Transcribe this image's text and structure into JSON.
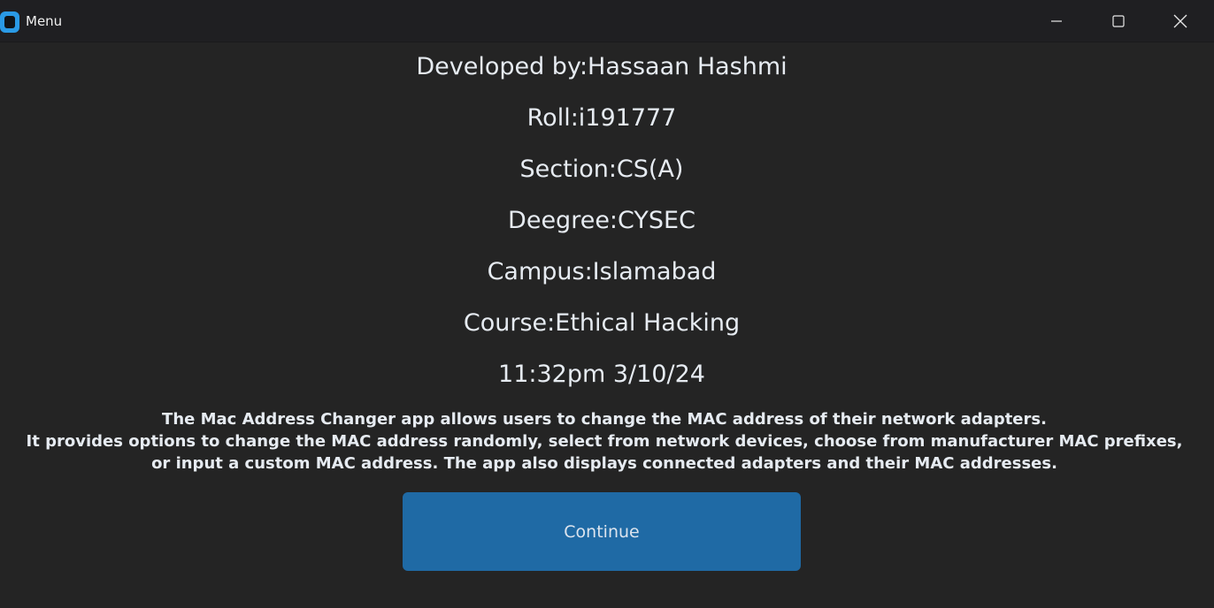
{
  "window": {
    "title": "Menu",
    "controls": {
      "minimize_icon": "minimize-icon",
      "maximize_icon": "maximize-icon",
      "close_icon": "close-icon"
    }
  },
  "info": {
    "developer": "Developed by:Hassaan Hashmi",
    "roll": "Roll:i191777",
    "section": "Section:CS(A)",
    "degree": "Deegree:CYSEC",
    "campus": "Campus:Islamabad",
    "course": "Course:Ethical Hacking",
    "datetime": "11:32pm 3/10/24"
  },
  "description": {
    "line1": "The Mac Address Changer app allows users to change the MAC address of their network adapters.",
    "line2": "It provides options to change the MAC address randomly, select from network devices, choose from manufacturer MAC prefixes,",
    "line3": "or input a custom MAC address. The app also displays connected adapters and their MAC addresses."
  },
  "actions": {
    "continue_label": "Continue"
  },
  "colors": {
    "background": "#242424",
    "titlebar": "#1f1f22",
    "button": "#1f6aa5",
    "text": "#e6ebf1",
    "app_icon": "#2a9ae6"
  }
}
